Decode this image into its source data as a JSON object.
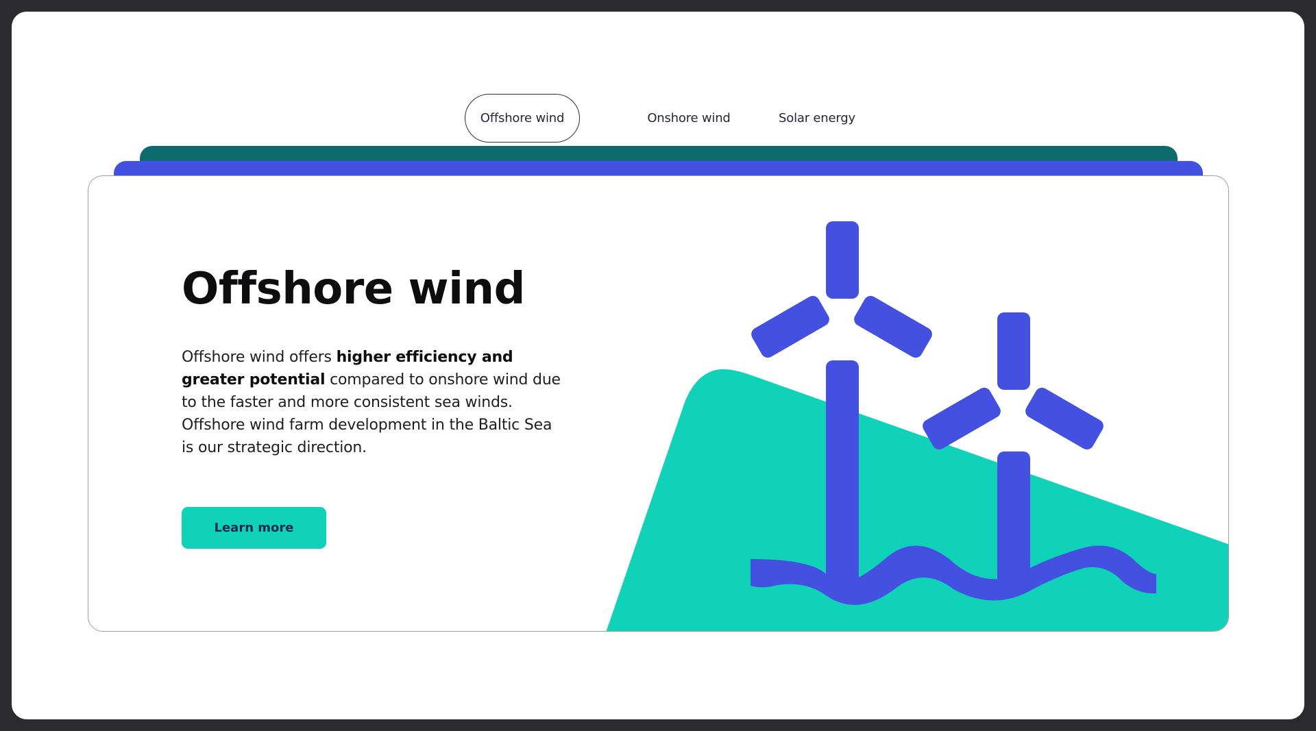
{
  "tabs": [
    {
      "label": "Offshore wind",
      "active": true
    },
    {
      "label": "Onshore wind",
      "active": false
    },
    {
      "label": "Solar energy",
      "active": false
    }
  ],
  "card": {
    "title": "Offshore wind",
    "description": {
      "part1": "Offshore wind offers ",
      "bold1": "higher efficiency and greater potential",
      "part2": " compared to onshore wind due to the faster and more consistent sea winds. Offshore wind farm development in the Baltic Sea is our strategic direction."
    },
    "cta_label": "Learn more",
    "illustration_icon": "offshore-wind-turbines-icon"
  },
  "colors": {
    "background_frame": "#2b2b2f",
    "accent_teal": "#0fd2b8",
    "accent_blue": "#4350e0",
    "accent_dark_green": "#0b6b6d",
    "text_dark": "#0d0d0f"
  }
}
